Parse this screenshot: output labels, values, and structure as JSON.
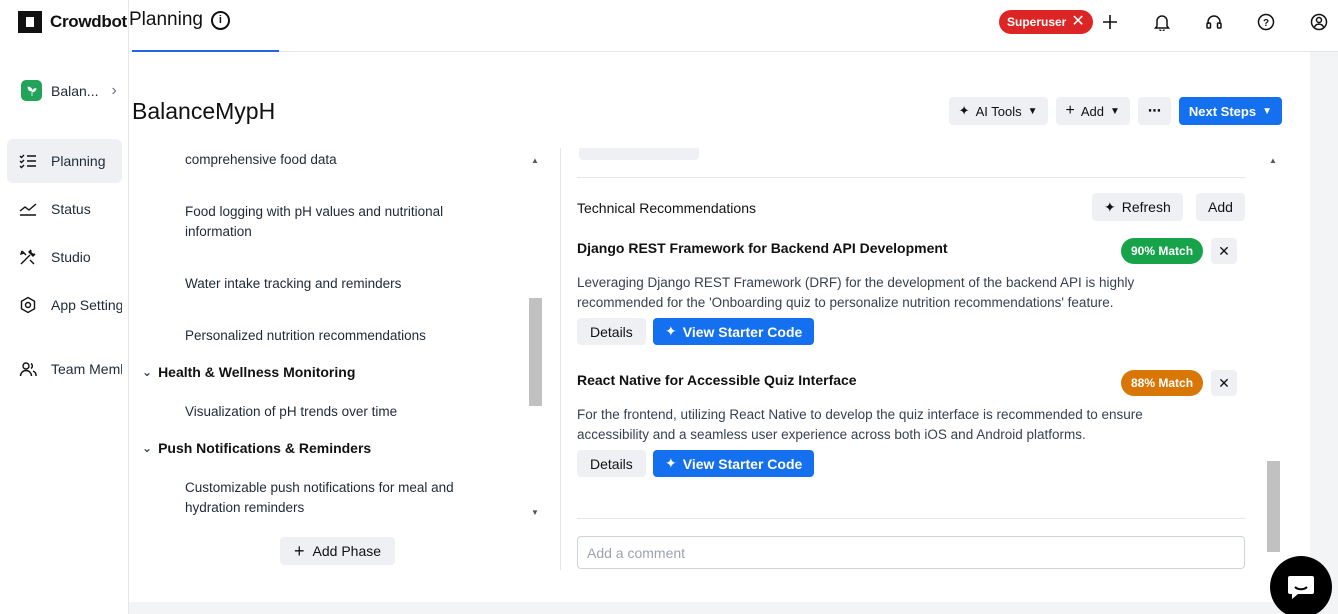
{
  "brand": {
    "name": "Crowdbotics"
  },
  "page": {
    "tab_title": "Planning"
  },
  "sidebar": {
    "project_name": "Balan...",
    "items": [
      {
        "label": "Planning",
        "icon": "checklist-icon",
        "active": true
      },
      {
        "label": "Status",
        "icon": "chart-line-icon"
      },
      {
        "label": "Studio",
        "icon": "tools-icon"
      },
      {
        "label": "App Settings",
        "icon": "settings-icon"
      },
      {
        "label": "Team Members",
        "icon": "users-icon"
      }
    ]
  },
  "topbar": {
    "superuser_label": "Superuser"
  },
  "project": {
    "title": "BalanceMypH"
  },
  "toolbar": {
    "ai_tools": "AI Tools",
    "add": "Add",
    "more": "⋯",
    "next_steps": "Next Steps"
  },
  "features": [
    "comprehensive food data",
    "Food logging with pH values and nutritional information",
    "Water intake tracking and reminders",
    "Personalized nutrition recommendations"
  ],
  "phases": [
    {
      "name": "Health & Wellness Monitoring",
      "features": [
        "Visualization of pH trends over time"
      ]
    },
    {
      "name": "Push Notifications & Reminders",
      "features": [
        "Customizable push notifications for meal and hydration reminders"
      ]
    }
  ],
  "add_phase_label": "Add Phase",
  "tech_recs": {
    "title": "Technical Recommendations",
    "refresh_label": "Refresh",
    "add_label": "Add",
    "items": [
      {
        "title": "Django REST Framework for Backend API Development",
        "match": "90% Match",
        "description": "Leveraging Django REST Framework (DRF) for the development of the backend API is highly recommended for the 'Onboarding quiz to personalize nutrition recommendations' feature.",
        "details_label": "Details",
        "starter_label": "View Starter Code"
      },
      {
        "title": "React Native for Accessible Quiz Interface",
        "match": "88% Match",
        "description": "For the frontend, utilizing React Native to develop the quiz interface is recommended to ensure accessibility and a seamless user experience across both iOS and Android platforms.",
        "details_label": "Details",
        "starter_label": "View Starter Code"
      }
    ]
  },
  "comment": {
    "placeholder": "Add a comment"
  },
  "colors": {
    "primary": "#1570ef",
    "danger": "#dc2626",
    "match_green": "#16a34a",
    "match_amber": "#d97706"
  }
}
